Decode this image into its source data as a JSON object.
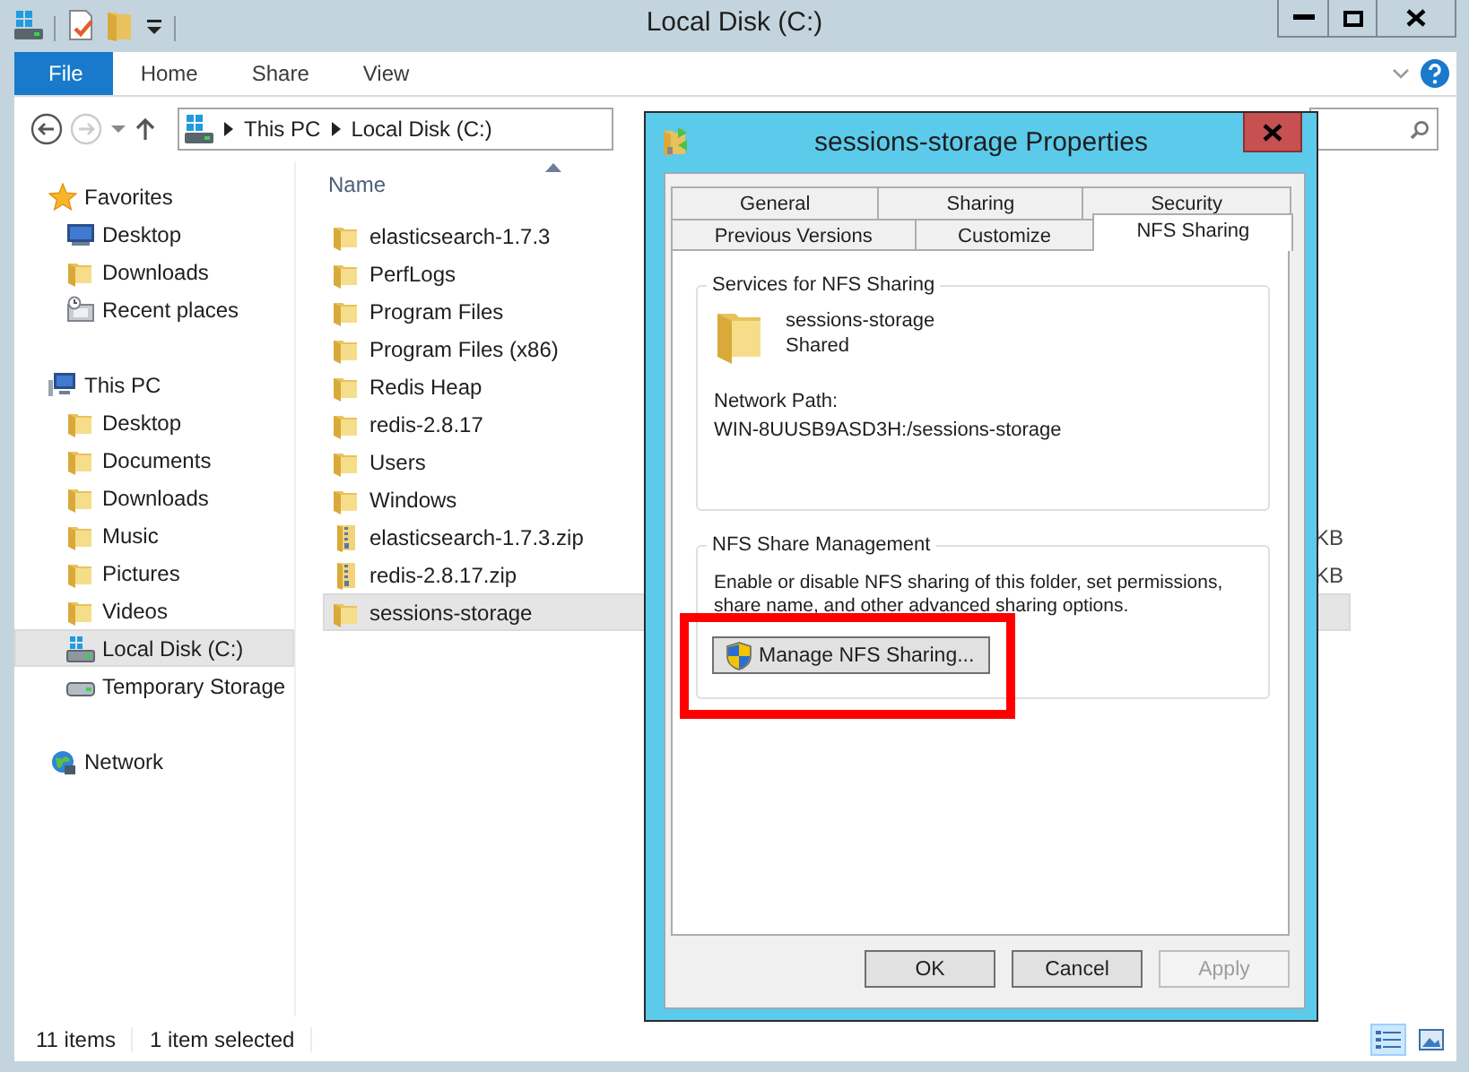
{
  "window": {
    "title": "Local Disk (C:)"
  },
  "ribbon_tabs": [
    {
      "label": "File",
      "selected": true
    },
    {
      "label": "Home",
      "selected": false
    },
    {
      "label": "Share",
      "selected": false
    },
    {
      "label": "View",
      "selected": false
    }
  ],
  "address_bar": {
    "crumbs": [
      "This PC",
      "Local Disk (C:)"
    ]
  },
  "sidebar": {
    "items": [
      {
        "label": "Favorites",
        "kind": "star",
        "selected": false,
        "children": [
          {
            "label": "Desktop",
            "kind": "monitor",
            "selected": false
          },
          {
            "label": "Downloads",
            "kind": "folder",
            "selected": false
          },
          {
            "label": "Recent places",
            "kind": "recent",
            "selected": false
          }
        ]
      },
      {
        "label": "This PC",
        "kind": "computer",
        "selected": false,
        "children": [
          {
            "label": "Desktop",
            "kind": "folder",
            "selected": false
          },
          {
            "label": "Documents",
            "kind": "folder",
            "selected": false
          },
          {
            "label": "Downloads",
            "kind": "folder",
            "selected": false
          },
          {
            "label": "Music",
            "kind": "folder",
            "selected": false
          },
          {
            "label": "Pictures",
            "kind": "folder",
            "selected": false
          },
          {
            "label": "Videos",
            "kind": "folder",
            "selected": false
          },
          {
            "label": "Local Disk (C:)",
            "kind": "system-drive",
            "selected": true
          },
          {
            "label": "Temporary Storage",
            "kind": "drive",
            "selected": false
          }
        ]
      },
      {
        "label": "Network",
        "kind": "network",
        "selected": false
      }
    ]
  },
  "file_list": {
    "columns": [
      "Name"
    ],
    "rows": [
      {
        "name": "elasticsearch-1.7.3",
        "kind": "folder",
        "selected": false
      },
      {
        "name": "PerfLogs",
        "kind": "folder",
        "selected": false
      },
      {
        "name": "Program Files",
        "kind": "folder",
        "selected": false
      },
      {
        "name": "Program Files (x86)",
        "kind": "folder",
        "selected": false
      },
      {
        "name": "Redis Heap",
        "kind": "folder",
        "selected": false
      },
      {
        "name": "redis-2.8.17",
        "kind": "folder",
        "selected": false
      },
      {
        "name": "Users",
        "kind": "folder",
        "selected": false
      },
      {
        "name": "Windows",
        "kind": "folder",
        "selected": false
      },
      {
        "name": "elasticsearch-1.7.3.zip",
        "kind": "zip",
        "size": "KB",
        "selected": false
      },
      {
        "name": "redis-2.8.17.zip",
        "kind": "zip",
        "size": "KB",
        "selected": false
      },
      {
        "name": "sessions-storage",
        "kind": "folder",
        "selected": true
      }
    ]
  },
  "status_bar": {
    "item_count": "11 items",
    "selection": "1 item selected"
  },
  "dialog": {
    "title": "sessions-storage Properties",
    "tab_rows": [
      {
        "tabs": [
          {
            "label": "General",
            "selected": false
          },
          {
            "label": "Sharing",
            "selected": false
          },
          {
            "label": "Security",
            "selected": false
          }
        ]
      },
      {
        "tabs": [
          {
            "label": "Previous Versions",
            "selected": false
          },
          {
            "label": "Customize",
            "selected": false
          },
          {
            "label": "NFS Sharing",
            "selected": true
          }
        ]
      }
    ],
    "services_group": {
      "title": "Services for NFS Sharing",
      "folder_name": "sessions-storage",
      "share_status": "Shared",
      "path_label": "Network Path:",
      "path": "WIN-8UUSB9ASD3H:/sessions-storage"
    },
    "management_group": {
      "title": "NFS Share Management",
      "description": "Enable or disable NFS sharing of this folder, set permissions, share name, and other advanced sharing options.",
      "button": "Manage NFS Sharing..."
    },
    "buttons": [
      {
        "label": "OK",
        "disabled": false
      },
      {
        "label": "Cancel",
        "disabled": false
      },
      {
        "label": "Apply",
        "disabled": true
      }
    ]
  }
}
